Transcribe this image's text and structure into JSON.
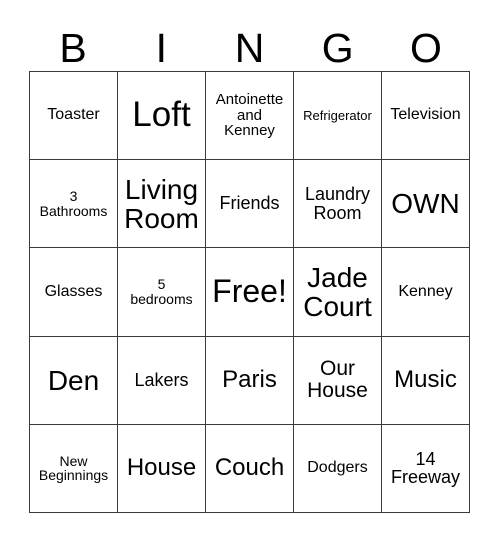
{
  "card": {
    "header_letters": [
      "B",
      "I",
      "N",
      "G",
      "O"
    ],
    "rows": [
      [
        {
          "text": "Toaster",
          "size": "m"
        },
        {
          "text": "Loft",
          "size": "mega"
        },
        {
          "text": "Antoinette\nand\nKenney",
          "size": "sm"
        },
        {
          "text": "Refrigerator",
          "size": "xs"
        },
        {
          "text": "Television",
          "size": "m"
        }
      ],
      [
        {
          "text": "3\nBathrooms",
          "size": "s"
        },
        {
          "text": "Living\nRoom",
          "size": "xxl"
        },
        {
          "text": "Friends",
          "size": "ml"
        },
        {
          "text": "Laundry\nRoom",
          "size": "ml"
        },
        {
          "text": "OWN",
          "size": "xxl"
        }
      ],
      [
        {
          "text": "Glasses",
          "size": "m"
        },
        {
          "text": "5\nbedrooms",
          "size": "s"
        },
        {
          "text": "Free!",
          "size": "huge"
        },
        {
          "text": "Jade\nCourt",
          "size": "xxl"
        },
        {
          "text": "Kenney",
          "size": "m"
        }
      ],
      [
        {
          "text": "Den",
          "size": "xxl"
        },
        {
          "text": "Lakers",
          "size": "ml"
        },
        {
          "text": "Paris",
          "size": "xl"
        },
        {
          "text": "Our\nHouse",
          "size": "l"
        },
        {
          "text": "Music",
          "size": "xl"
        }
      ],
      [
        {
          "text": "New\nBeginnings",
          "size": "s"
        },
        {
          "text": "House",
          "size": "xl"
        },
        {
          "text": "Couch",
          "size": "xl"
        },
        {
          "text": "Dodgers",
          "size": "m"
        },
        {
          "text": "14\nFreeway",
          "size": "ml"
        }
      ]
    ],
    "colors": {
      "border": "#3a3a3a",
      "text": "#000000",
      "background": "#ffffff"
    }
  }
}
